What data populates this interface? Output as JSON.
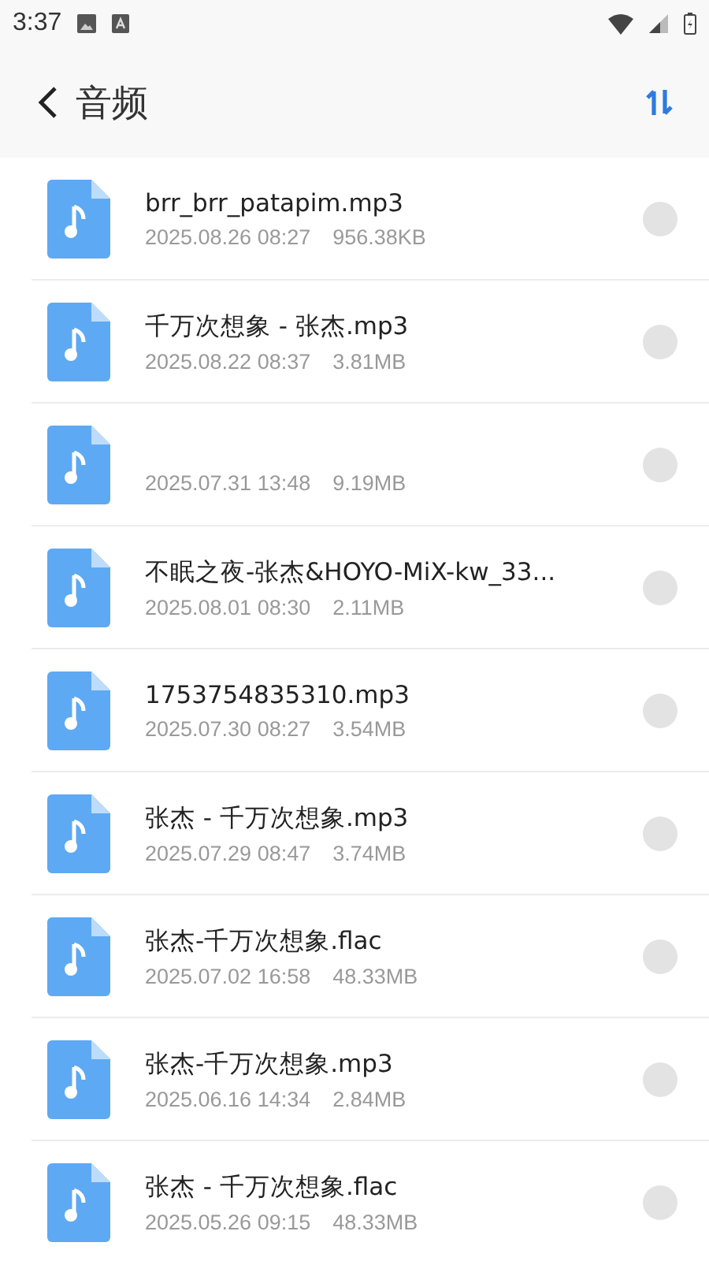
{
  "status_bar": {
    "time": "3:37"
  },
  "header": {
    "title": "音频"
  },
  "files": [
    {
      "name": "brr_brr_patapim.mp3",
      "date": "2025.08.26 08:27",
      "size": "956.38KB",
      "selected": false
    },
    {
      "name": "千万次想象 - 张杰.mp3",
      "date": "2025.08.22 08:37",
      "size": "3.81MB",
      "selected": false
    },
    {
      "date": "2025.07.31 13:48",
      "size": "9.19MB",
      "selected": false
    },
    {
      "name": "不眠之夜-张杰&HOYO-MiX-kw_33...",
      "date": "2025.08.01 08:30",
      "size": "2.11MB",
      "selected": false
    },
    {
      "name": "1753754835310.mp3",
      "date": "2025.07.30 08:27",
      "size": "3.54MB",
      "selected": false
    },
    {
      "name": "张杰 - 千万次想象.mp3",
      "date": "2025.07.29 08:47",
      "size": "3.74MB",
      "selected": false
    },
    {
      "name": "张杰-千万次想象.flac",
      "date": "2025.07.02 16:58",
      "size": "48.33MB",
      "selected": false
    },
    {
      "name": "张杰-千万次想象.mp3",
      "date": "2025.06.16 14:34",
      "size": "2.84MB",
      "selected": false
    },
    {
      "name": "张杰 - 千万次想象.flac",
      "date": "2025.05.26 09:15",
      "size": "48.33MB",
      "selected": false
    }
  ]
}
